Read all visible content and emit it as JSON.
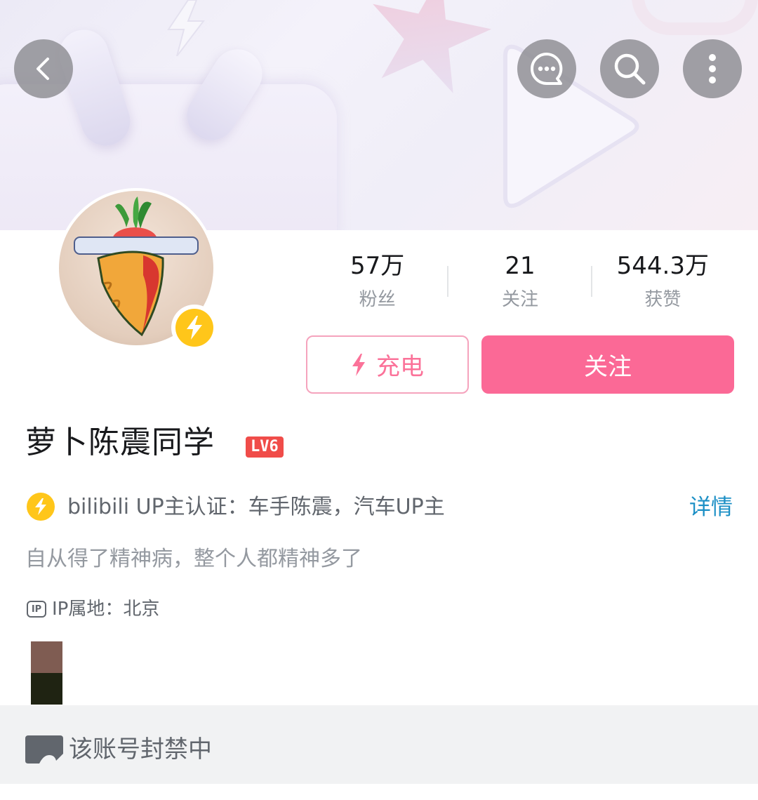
{
  "header": {
    "back_icon": "chevron-left-icon",
    "actions": [
      "message-bubble-icon",
      "search-icon",
      "more-vertical-icon"
    ]
  },
  "profile": {
    "avatar_icon": "carrot-avatar",
    "verify_badge_icon": "lightning-icon",
    "name": "萝卜陈震同学",
    "level": "LV6",
    "certification": "bilibili UP主认证：车手陈震，汽车UP主",
    "certification_detail": "详情",
    "bio": "自从得了精神病，整个人都精神多了",
    "ip_badge": "IP",
    "ip_location": "IP属地：北京"
  },
  "stats": [
    {
      "value": "57万",
      "label": "粉丝"
    },
    {
      "value": "21",
      "label": "关注"
    },
    {
      "value": "544.3万",
      "label": "获赞"
    }
  ],
  "buttons": {
    "charge": "充电",
    "follow": "关注"
  },
  "notice": {
    "text": "该账号封禁中"
  },
  "colors": {
    "accent_pink": "#fb6996",
    "verify_yellow": "#ffc61a",
    "level_red": "#f04c49",
    "detail_blue": "#1b8fc5"
  }
}
